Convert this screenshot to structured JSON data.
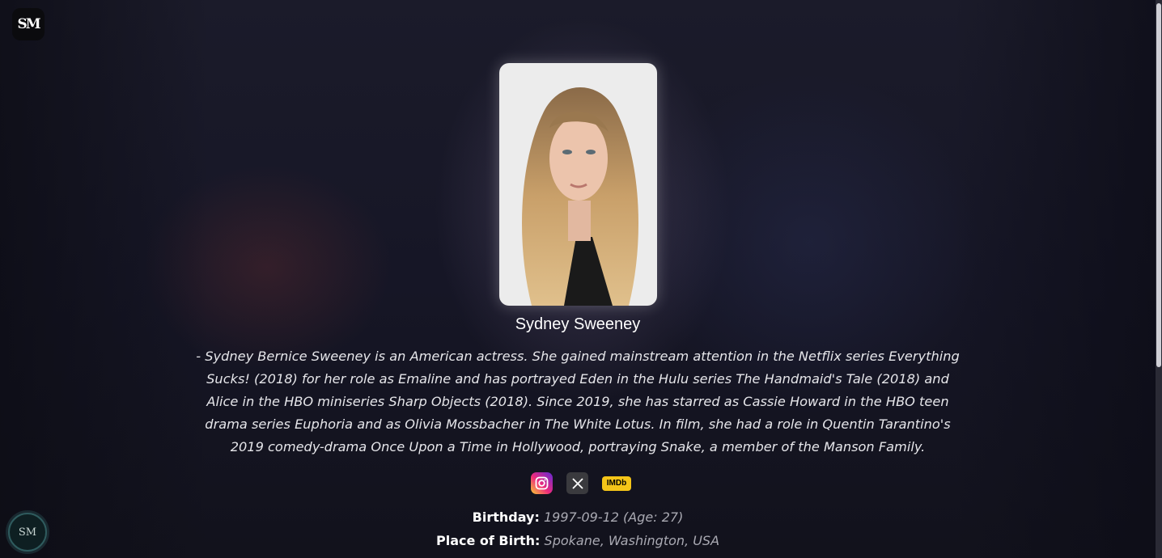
{
  "logo": {
    "text": "SM"
  },
  "profile": {
    "name": "Sydney Sweeney",
    "bio": "- Sydney Bernice Sweeney is an American actress. She gained mainstream attention in the Netflix series Everything Sucks! (2018) for her role as Emaline and has portrayed Eden in the Hulu series The Handmaid's Tale (2018) and Alice in the HBO miniseries Sharp Objects (2018). Since 2019, she has starred as Cassie Howard in the HBO teen drama series Euphoria and as Olivia Mossbacher in The White Lotus. In film, she had a role in Quentin Tarantino's 2019 comedy-drama Once Upon a Time in Hollywood, portraying Snake, a member of the Manson Family."
  },
  "socials": {
    "instagram_icon": "instagram-icon",
    "x_icon": "x-icon",
    "imdb_label": "IMDb"
  },
  "details": {
    "birthday_label": "Birthday:",
    "birthday_value": "1997-09-12 (Age: 27)",
    "birthplace_label": "Place of Birth:",
    "birthplace_value": "Spokane, Washington, USA"
  },
  "badge": {
    "text": "SM"
  },
  "colors": {
    "background": "#14141f",
    "imdb": "#f5c518",
    "text_primary": "#ffffff",
    "text_muted": "#a9a9b2"
  }
}
